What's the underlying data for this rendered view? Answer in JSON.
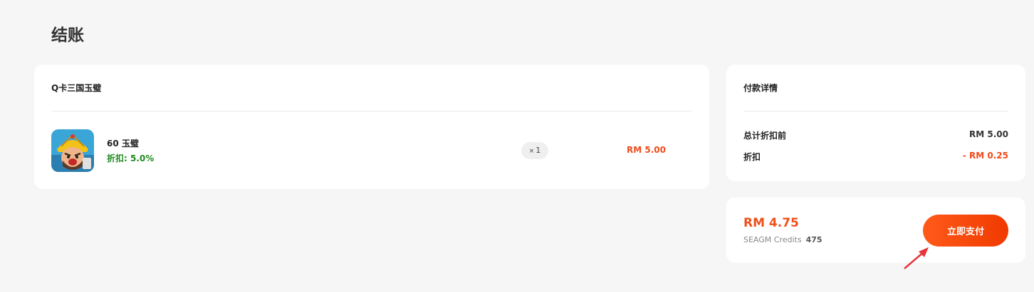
{
  "page": {
    "title": "结账"
  },
  "order": {
    "game_name": "Q卡三国玉璧",
    "items": [
      {
        "name": "60 玉璧",
        "discount_label": "折扣: 5.0%",
        "qty_prefix": "×",
        "qty": "1",
        "price": "RM 5.00",
        "icon": "game-hero-icon"
      }
    ]
  },
  "payment_details": {
    "title": "付款详情",
    "rows": [
      {
        "label": "总计折扣前",
        "value": "RM 5.00"
      },
      {
        "label": "折扣",
        "value": "- RM 0.25"
      }
    ]
  },
  "checkout": {
    "total": "RM 4.75",
    "credits_label": "SEAGM Credits",
    "credits_value": "475",
    "pay_button_label": "立即支付"
  },
  "colors": {
    "accent": "#f04a1a",
    "discount_green": "#1f8a1f",
    "background": "#f6f6f6"
  }
}
